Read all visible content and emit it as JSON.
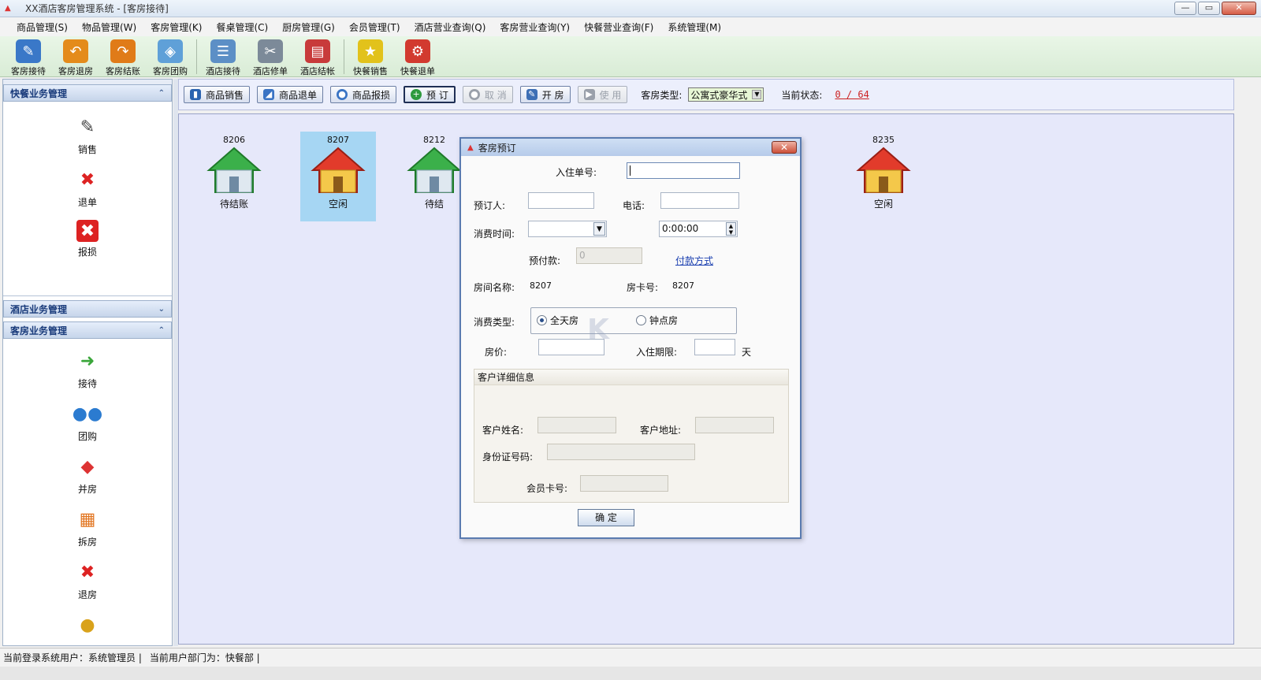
{
  "window": {
    "title": "XX酒店客房管理系统 - [客房接待]",
    "btn_min": "—",
    "btn_restore": "▭",
    "btn_close": "✕"
  },
  "menu": [
    "商品管理(S)",
    "物品管理(W)",
    "客房管理(K)",
    "餐桌管理(C)",
    "厨房管理(G)",
    "会员管理(T)",
    "酒店营业查询(Q)",
    "客房营业查询(Y)",
    "快餐营业查询(F)",
    "系统管理(M)"
  ],
  "toolbar": {
    "items": [
      {
        "label": "客房接待",
        "icon": "pencil-icon",
        "color": "#3a78c8"
      },
      {
        "label": "客房退房",
        "icon": "return-arrow-icon",
        "color": "#e48b1b"
      },
      {
        "label": "客房结账",
        "icon": "checkout-arrow-icon",
        "color": "#e07b18"
      },
      {
        "label": "客房团购",
        "icon": "ticket-icon",
        "color": "#5fa0d8"
      },
      {
        "label": "酒店接待",
        "icon": "id-card-icon",
        "color": "#5c8fc6"
      },
      {
        "label": "酒店修单",
        "icon": "tools-icon",
        "color": "#7c8a99"
      },
      {
        "label": "酒店结帐",
        "icon": "report-icon",
        "color": "#c83b3b"
      },
      {
        "label": "快餐销售",
        "icon": "star-icon",
        "color": "#e2c21b"
      },
      {
        "label": "快餐退单",
        "icon": "gear-icon",
        "color": "#d23a2f"
      }
    ]
  },
  "sidebar": {
    "panel1": {
      "title": "快餐业务管理",
      "items": [
        {
          "label": "销售",
          "icon": "edit-icon",
          "glyph": "✎",
          "color": "#555"
        },
        {
          "label": "退单",
          "icon": "delete-doc-icon",
          "glyph": "✖",
          "color": "#d22"
        },
        {
          "label": "报损",
          "icon": "damage-icon",
          "glyph": "✖",
          "color": "#d22"
        }
      ]
    },
    "panel2": {
      "title": "酒店业务管理"
    },
    "panel3": {
      "title": "客房业务管理",
      "items": [
        {
          "label": "接待",
          "icon": "arrow-right-icon",
          "glyph": "➜",
          "color": "#3aa63a"
        },
        {
          "label": "团购",
          "icon": "group-icon",
          "glyph": "👥",
          "color": "#2b7bd0"
        },
        {
          "label": "并房",
          "icon": "merge-cubes-icon",
          "glyph": "◆",
          "color": "#d33"
        },
        {
          "label": "拆房",
          "icon": "split-tree-icon",
          "glyph": "▦",
          "color": "#e27520"
        },
        {
          "label": "退房",
          "icon": "delete-doc-icon",
          "glyph": "✖",
          "color": "#d22"
        },
        {
          "label": "结账",
          "icon": "coins-icon",
          "glyph": "●",
          "color": "#d9a21b"
        }
      ]
    }
  },
  "actionbar": {
    "buttons": [
      {
        "label": "商品销售",
        "icon": "sale-icon",
        "color": "#2a63b0",
        "state": "normal"
      },
      {
        "label": "商品退单",
        "icon": "refund-icon",
        "color": "#3a74c4",
        "state": "normal"
      },
      {
        "label": "商品报损",
        "icon": "damage-icon",
        "color": "#3a74c4",
        "state": "normal"
      },
      {
        "label": "预  订",
        "icon": "plus-icon",
        "color": "#2e9a3e",
        "state": "active"
      },
      {
        "label": "取  消",
        "icon": "cancel-icon",
        "color": "#9aa0aa",
        "state": "disabled"
      },
      {
        "label": "开  房",
        "icon": "pen-icon",
        "color": "#3d6fb5",
        "state": "normal"
      },
      {
        "label": "使  用",
        "icon": "play-icon",
        "color": "#9aa0aa",
        "state": "disabled"
      }
    ],
    "room_type_label": "客房类型:",
    "room_type_value": "公寓式豪华式",
    "status_label": "当前状态:",
    "status_value": "0 / 64"
  },
  "rooms": [
    {
      "number": "8206",
      "status": "待结账",
      "color": "green",
      "selected": false
    },
    {
      "number": "8207",
      "status": "空闲",
      "color": "red",
      "selected": true
    },
    {
      "number": "8212",
      "status": "待结",
      "color": "green",
      "selected": false
    },
    {
      "number": "8235",
      "status": "空闲",
      "color": "red",
      "selected": false
    }
  ],
  "dialog": {
    "title": "客房预订",
    "checkin_no_label": "入住单号:",
    "booker_label": "预订人:",
    "phone_label": "电话:",
    "time_label": "消费时间:",
    "time_value": "0:00:00",
    "prepay_label": "预付款:",
    "prepay_value": "0",
    "pay_method_link": "付款方式",
    "room_name_label": "房间名称:",
    "room_name_value": "8207",
    "room_card_label": "房卡号:",
    "room_card_value": "8207",
    "consume_type_label": "消费类型:",
    "opt_fullday": "全天房",
    "opt_hourly": "钟点房",
    "price_label": "房价:",
    "stay_limit_label": "入住期限:",
    "day_unit": "天",
    "customer_section": "客户详细信息",
    "cust_name_label": "客户姓名:",
    "cust_addr_label": "客户地址:",
    "id_label": "身份证号码:",
    "member_label": "会员卡号:",
    "ok_label": "确  定"
  },
  "statusbar": {
    "user": "当前登录系统用户：系统管理员 |",
    "dept": "当前用户部门为：快餐部 |"
  }
}
